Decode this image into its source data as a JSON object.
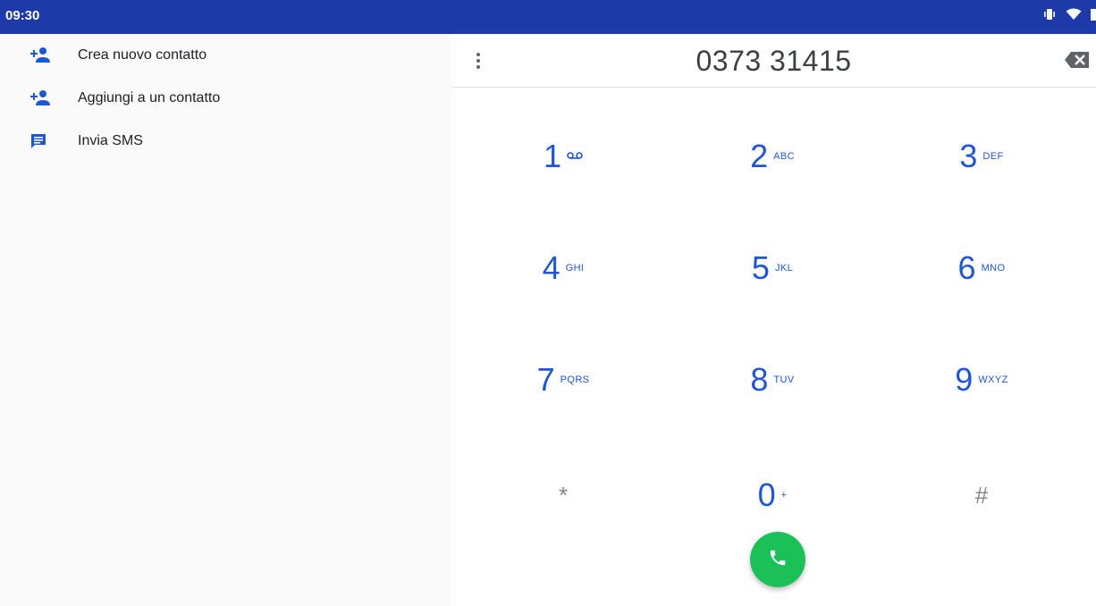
{
  "status": {
    "time": "09:30",
    "bar_color": "#1e39a8",
    "icons": [
      "vibrate-icon",
      "wifi-icon",
      "battery-icon"
    ]
  },
  "left_menu": {
    "items": [
      {
        "label": "Crea nuovo contatto",
        "icon": "add-person-icon"
      },
      {
        "label": "Aggiungi a un contatto",
        "icon": "add-person-icon"
      },
      {
        "label": "Invia SMS",
        "icon": "message-icon"
      }
    ]
  },
  "dialer": {
    "number": "0373 31415",
    "accent_color": "#1e56d6",
    "call_button_color": "#1bc156",
    "keys": [
      {
        "digit": "1",
        "letters": "",
        "icon": "voicemail-icon"
      },
      {
        "digit": "2",
        "letters": "ABC"
      },
      {
        "digit": "3",
        "letters": "DEF"
      },
      {
        "digit": "4",
        "letters": "GHI"
      },
      {
        "digit": "5",
        "letters": "JKL"
      },
      {
        "digit": "6",
        "letters": "MNO"
      },
      {
        "digit": "7",
        "letters": "PQRS"
      },
      {
        "digit": "8",
        "letters": "TUV"
      },
      {
        "digit": "9",
        "letters": "WXYZ"
      },
      {
        "digit": "*",
        "letters": ""
      },
      {
        "digit": "0",
        "letters": "+"
      },
      {
        "digit": "#",
        "letters": ""
      }
    ]
  }
}
